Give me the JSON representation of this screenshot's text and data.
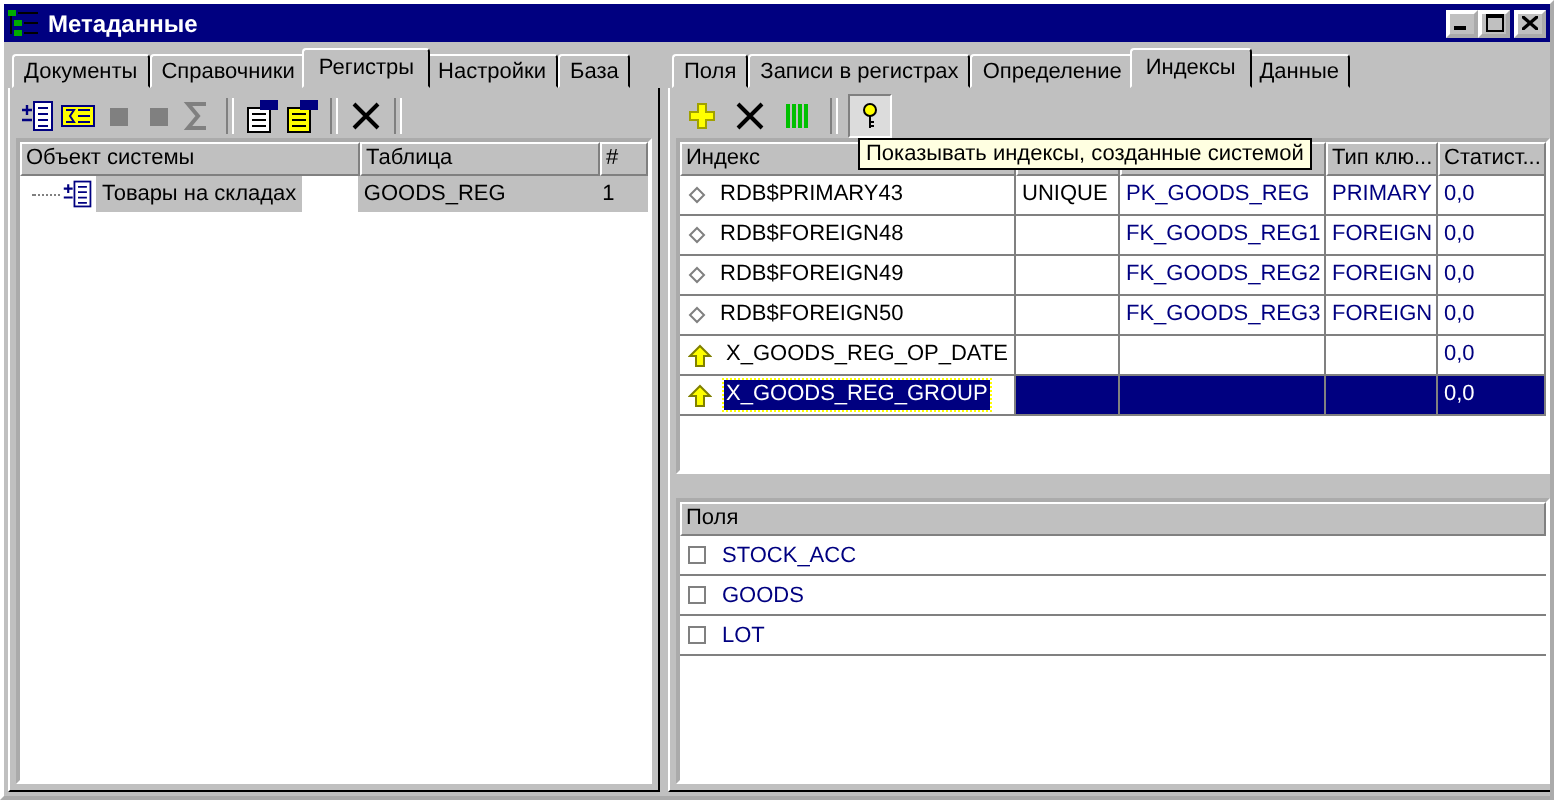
{
  "window": {
    "title": "Метаданные"
  },
  "left": {
    "tabs": [
      {
        "label": "Документы",
        "selected": false
      },
      {
        "label": "Справочники",
        "selected": false
      },
      {
        "label": "Регистры",
        "selected": true
      },
      {
        "label": "Настройки",
        "selected": false
      },
      {
        "label": "База",
        "selected": false
      }
    ],
    "toolbar": [
      {
        "kind": "tree-add",
        "disabled": false
      },
      {
        "kind": "sum-box",
        "disabled": false
      },
      {
        "kind": "square",
        "disabled": true
      },
      {
        "kind": "square",
        "disabled": true
      },
      {
        "kind": "sigma",
        "disabled": true
      },
      {
        "kind": "sep"
      },
      {
        "kind": "props",
        "disabled": false
      },
      {
        "kind": "props-yellow",
        "disabled": false
      },
      {
        "kind": "sep"
      },
      {
        "kind": "delete",
        "disabled": false
      },
      {
        "kind": "sep"
      }
    ],
    "table": {
      "columns": [
        "Объект системы",
        "Таблица",
        "#"
      ],
      "rows": [
        {
          "name": "Товары на складах",
          "table": "GOODS_REG",
          "count": "1",
          "selected": true
        }
      ]
    }
  },
  "right": {
    "tabs": [
      {
        "label": "Поля",
        "selected": false
      },
      {
        "label": "Записи в регистрах",
        "selected": false
      },
      {
        "label": "Определение",
        "selected": false
      },
      {
        "label": "Индексы",
        "selected": true
      },
      {
        "label": "Данные",
        "selected": false
      }
    ],
    "toolbar": [
      {
        "kind": "add",
        "pressed": false
      },
      {
        "kind": "delete",
        "pressed": false
      },
      {
        "kind": "columns",
        "pressed": false
      },
      {
        "kind": "sep"
      },
      {
        "kind": "key",
        "pressed": true
      }
    ],
    "tooltip": "Показывать индексы, созданные системой",
    "indexes": {
      "columns": [
        "Индекс",
        "Тип клю...",
        "Статист..."
      ],
      "rows": [
        {
          "kind": "system",
          "name": "RDB$PRIMARY43",
          "column_2": "UNIQUE",
          "column_3": "PK_GOODS_REG",
          "type": "PRIMARY",
          "stat": "0,0",
          "selected": false
        },
        {
          "kind": "system",
          "name": "RDB$FOREIGN48",
          "column_2": "",
          "column_3": "FK_GOODS_REG1",
          "type": "FOREIGN",
          "stat": "0,0",
          "selected": false
        },
        {
          "kind": "system",
          "name": "RDB$FOREIGN49",
          "column_2": "",
          "column_3": "FK_GOODS_REG2",
          "type": "FOREIGN",
          "stat": "0,0",
          "selected": false
        },
        {
          "kind": "system",
          "name": "RDB$FOREIGN50",
          "column_2": "",
          "column_3": "FK_GOODS_REG3",
          "type": "FOREIGN",
          "stat": "0,0",
          "selected": false
        },
        {
          "kind": "user",
          "name": "X_GOODS_REG_OP_DATE",
          "column_2": "",
          "column_3": "",
          "type": "",
          "stat": "0,0",
          "selected": false
        },
        {
          "kind": "user",
          "name": "X_GOODS_REG_GROUP",
          "column_2": "",
          "column_3": "",
          "type": "",
          "stat": "0,0",
          "selected": true
        }
      ]
    },
    "fields": {
      "header": "Поля",
      "rows": [
        {
          "name": "STOCK_ACC",
          "checked": false
        },
        {
          "name": "GOODS",
          "checked": false
        },
        {
          "name": "LOT",
          "checked": false
        }
      ]
    }
  }
}
